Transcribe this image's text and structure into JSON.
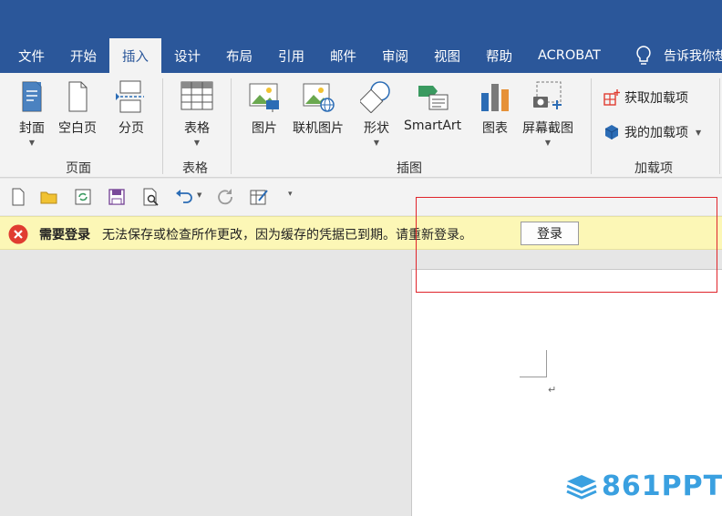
{
  "tabs": [
    "文件",
    "开始",
    "插入",
    "设计",
    "布局",
    "引用",
    "邮件",
    "审阅",
    "视图",
    "帮助",
    "ACROBAT"
  ],
  "active_tab": "插入",
  "tell_me": "告诉我你想",
  "ribbon": {
    "pages": {
      "cover": "封面",
      "blank": "空白页",
      "break": "分页",
      "group": "页面"
    },
    "tables": {
      "table": "表格",
      "group": "表格"
    },
    "illustrations": {
      "picture": "图片",
      "online_picture": "联机图片",
      "shapes": "形状",
      "smartart": "SmartArt",
      "chart": "图表",
      "screenshot": "屏幕截图",
      "group": "插图"
    },
    "addins": {
      "get": "获取加载项",
      "mine": "我的加载项",
      "group": "加载项"
    }
  },
  "message_bar": {
    "title": "需要登录",
    "text": "无法保存或检查所作更改，因为缓存的凭据已到期。请重新登录。",
    "button": "登录"
  },
  "paragraph_mark": "↵",
  "watermark": "861PPT",
  "colors": {
    "brand": "#2b579a",
    "ribbon_bg": "#f3f3f3",
    "message_bg": "#fcf7b6",
    "error": "#e03c31",
    "highlight": "#e0242a",
    "watermark": "#3aa0e0"
  }
}
